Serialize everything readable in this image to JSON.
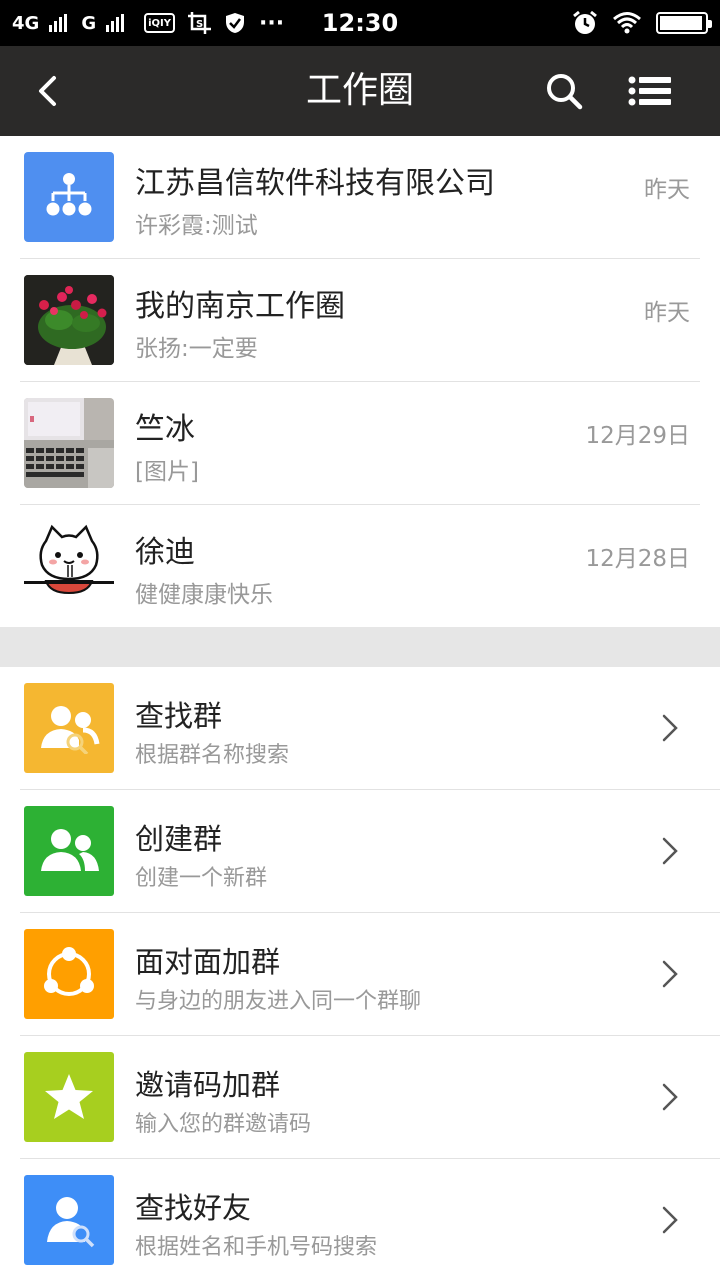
{
  "status_bar": {
    "network": "4G",
    "network2": "G",
    "iqiyi_badge": "iQIY",
    "time": "12:30",
    "dots": "···",
    "battery_level": 0.95
  },
  "titlebar": {
    "title": "工作圈"
  },
  "circles": [
    {
      "name": "江苏昌信软件科技有限公司",
      "preview": "许彩霞:测试",
      "time": "昨天",
      "avatar": "org-chart-icon"
    },
    {
      "name": "我的南京工作圈",
      "preview": "张扬:一定要",
      "time": "昨天",
      "avatar": "roses-photo"
    },
    {
      "name": "竺冰",
      "preview": "[图片]",
      "time": "12月29日",
      "avatar": "laptop-photo"
    },
    {
      "name": "徐迪",
      "preview": "健健康康快乐",
      "time": "12月28日",
      "avatar": "cat-noodles-avatar"
    }
  ],
  "actions": [
    {
      "title": "查找群",
      "subtitle": "根据群名称搜索",
      "color": "#f5b731",
      "icon": "search-group-icon"
    },
    {
      "title": "创建群",
      "subtitle": "创建一个新群",
      "color": "#2db134",
      "icon": "create-group-icon"
    },
    {
      "title": "面对面加群",
      "subtitle": "与身边的朋友进入同一个群聊",
      "color": "#ff9f00",
      "icon": "face-to-face-icon"
    },
    {
      "title": "邀请码加群",
      "subtitle": "输入您的群邀请码",
      "color": "#a7cf1f",
      "icon": "star-icon"
    },
    {
      "title": "查找好友",
      "subtitle": "根据姓名和手机号码搜索",
      "color": "#3e8ef7",
      "icon": "find-friend-icon"
    }
  ]
}
